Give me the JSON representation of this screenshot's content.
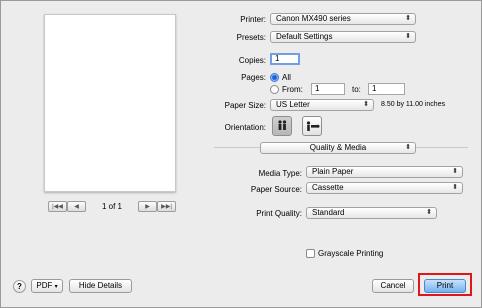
{
  "printer": {
    "label": "Printer:",
    "value": "Canon MX490 series"
  },
  "presets": {
    "label": "Presets:",
    "value": "Default Settings"
  },
  "copies": {
    "label": "Copies:",
    "value": "1"
  },
  "pages": {
    "label": "Pages:",
    "all_label": "All",
    "from_label": "From:",
    "from_value": "1",
    "to_label": "to:",
    "to_value": "1",
    "selected": "All"
  },
  "paper_size": {
    "label": "Paper Size:",
    "value": "US Letter",
    "dims": "8.50 by 11.00 inches"
  },
  "orientation": {
    "label": "Orientation:",
    "options": [
      "portrait",
      "landscape"
    ],
    "selected": "portrait"
  },
  "section_popup": {
    "value": "Quality & Media"
  },
  "media_type": {
    "label": "Media Type:",
    "value": "Plain Paper"
  },
  "paper_source": {
    "label": "Paper Source:",
    "value": "Cassette"
  },
  "print_quality": {
    "label": "Print Quality:",
    "value": "Standard"
  },
  "grayscale": {
    "label": "Grayscale Printing",
    "checked": false
  },
  "preview_nav": {
    "page_text": "1 of 1"
  },
  "footer": {
    "help": "?",
    "pdf_label": "PDF",
    "hide_details_label": "Hide Details",
    "cancel_label": "Cancel",
    "print_label": "Print"
  },
  "colors": {
    "highlight": "#e0161a",
    "primary_button": "#73b2ee"
  }
}
